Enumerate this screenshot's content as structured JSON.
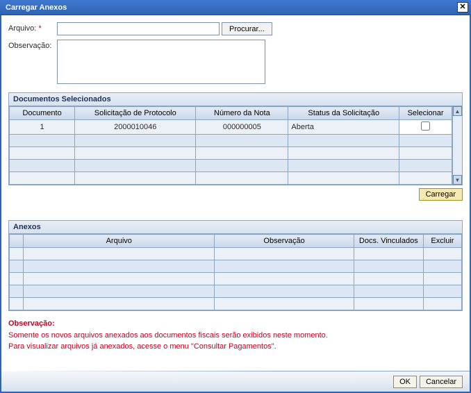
{
  "title": "Carregar Anexos",
  "form": {
    "arquivo_label": "Arquivo:",
    "arquivo_value": "",
    "browse_label": "Procurar...",
    "observacao_label": "Observação:",
    "observacao_value": ""
  },
  "docsel": {
    "panel_title": "Documentos Selecionados",
    "headers": {
      "documento": "Documento",
      "solicitacao": "Solicitação de Protocolo",
      "numero": "Número da Nota",
      "status": "Status da Solicitação",
      "selecionar": "Selecionar"
    },
    "rows": [
      {
        "documento": "1",
        "solicitacao": "2000010046",
        "numero": "000000005",
        "status": "Aberta",
        "selected": false
      }
    ],
    "carregar_label": "Carregar"
  },
  "anexos": {
    "panel_title": "Anexos",
    "headers": {
      "arquivo": "Arquivo",
      "observacao": "Observação",
      "docs_vinculados": "Docs. Vinculados",
      "excluir": "Excluir"
    }
  },
  "obs_note": {
    "heading": "Observação:",
    "line1": "Somente os novos arquivos anexados aos documentos fiscais serão exibidos neste momento.",
    "line2": "Para visualizar arquivos já anexados, acesse o menu \"Consultar Pagamentos\"."
  },
  "footer": {
    "ok_label": "OK",
    "cancel_label": "Cancelar"
  }
}
